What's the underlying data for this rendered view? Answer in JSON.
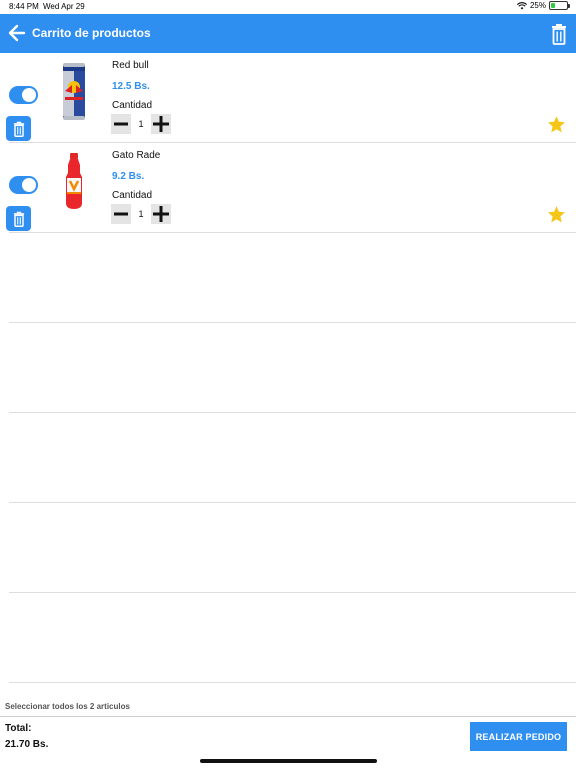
{
  "status_bar": {
    "time": "8:44 PM",
    "date": "Wed Apr 29",
    "battery": "25%",
    "battery_level": 0.25
  },
  "header": {
    "title": "Carrito de productos",
    "back_icon": "arrow-left-icon",
    "trash_icon": "trash-icon"
  },
  "items": [
    {
      "name": "Red bull",
      "price": "12.5 Bs.",
      "quantity_label": "Cantidad",
      "quantity": "1",
      "selected": true,
      "favorite": true
    },
    {
      "name": "Gato Rade",
      "price": "9.2 Bs.",
      "quantity_label": "Cantidad",
      "quantity": "1",
      "selected": true,
      "favorite": true
    }
  ],
  "select_all_text": "Seleccionar todos los 2 articulos",
  "footer": {
    "total_label": "Total:",
    "total_value": "21.70 Bs.",
    "order_button": "REALIZAR PEDIDO"
  },
  "colors": {
    "accent": "#2f8ff0",
    "star": "#f5c518"
  }
}
